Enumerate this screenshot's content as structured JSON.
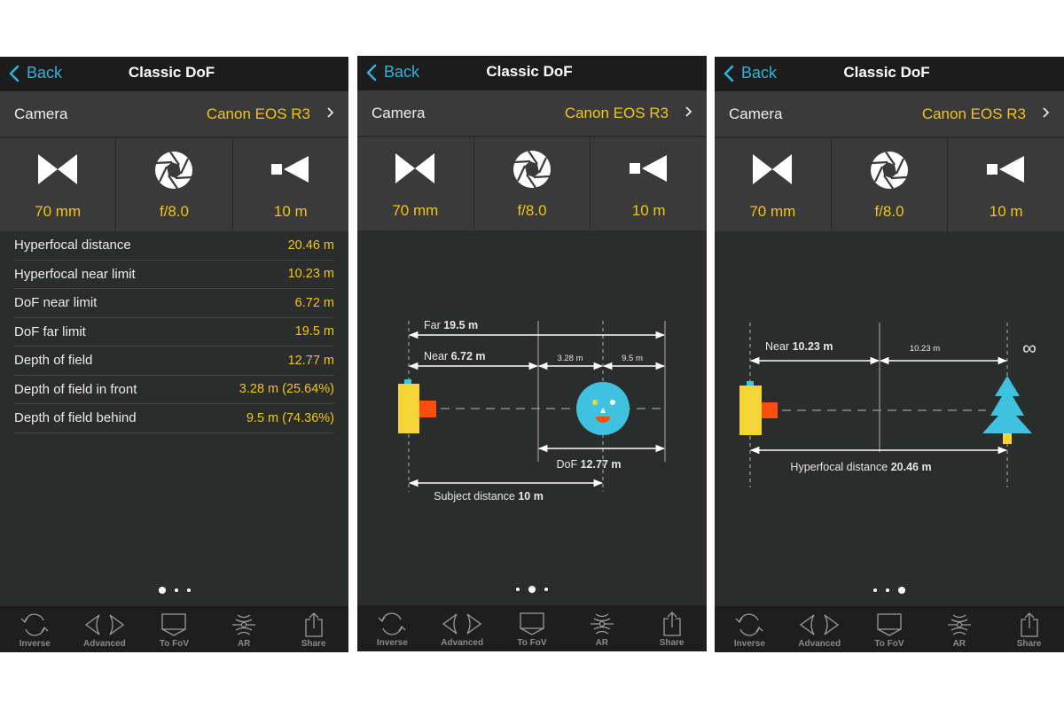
{
  "nav": {
    "back_label": "Back",
    "title": "Classic DoF"
  },
  "camera": {
    "label": "Camera",
    "value": "Canon EOS R3"
  },
  "params": [
    {
      "icon": "focal-length-icon",
      "value": "70 mm"
    },
    {
      "icon": "aperture-icon",
      "value": "f/8.0"
    },
    {
      "icon": "subject-distance-icon",
      "value": "10 m"
    }
  ],
  "results": [
    {
      "label": "Hyperfocal distance",
      "value": "20.46 m"
    },
    {
      "label": "Hyperfocal near limit",
      "value": "10.23 m"
    },
    {
      "label": "DoF near limit",
      "value": "6.72 m"
    },
    {
      "label": "DoF far limit",
      "value": "19.5 m"
    },
    {
      "label": "Depth of field",
      "value": "12.77 m"
    },
    {
      "label": "Depth of field in front",
      "value": "3.28 m (25.64%)"
    },
    {
      "label": "Depth of field behind",
      "value": "9.5 m (74.36%)"
    }
  ],
  "dof_diagram": {
    "far_label": "Far",
    "far_value": "19.5 m",
    "near_label": "Near",
    "near_value": "6.72 m",
    "front_value": "3.28 m",
    "behind_value": "9.5 m",
    "dof_label": "DoF",
    "dof_value": "12.77 m",
    "subject_label": "Subject distance",
    "subject_value": "10 m"
  },
  "hyperfocal_diagram": {
    "near_label": "Near",
    "near_value": "10.23 m",
    "beyond_value": "10.23 m",
    "infinity_symbol": "∞",
    "hyper_label": "Hyperfocal distance",
    "hyper_value": "20.46 m"
  },
  "pages": {
    "count": 3,
    "active": [
      0,
      1,
      2
    ]
  },
  "tabbar": [
    {
      "icon": "inverse-icon",
      "label": "Inverse"
    },
    {
      "icon": "advanced-icon",
      "label": "Advanced"
    },
    {
      "icon": "to-fov-icon",
      "label": "To FoV"
    },
    {
      "icon": "ar-icon",
      "label": "AR"
    },
    {
      "icon": "share-icon",
      "label": "Share"
    }
  ],
  "colors": {
    "accent_yellow": "#f0c419",
    "accent_blue": "#2fb3d9",
    "subject_cyan": "#3fc1e0",
    "lens_orange": "#ff4d0d"
  }
}
